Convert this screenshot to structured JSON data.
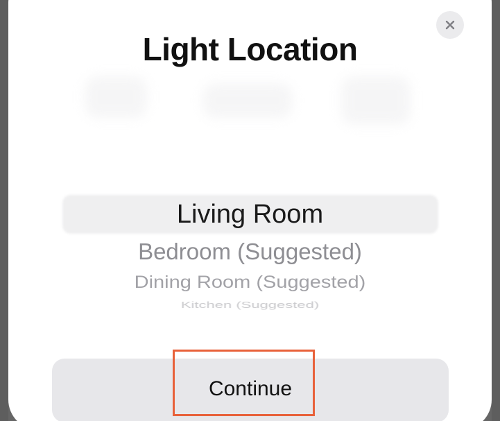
{
  "dialog": {
    "title": "Light Location",
    "close_icon": "close-icon"
  },
  "picker": {
    "selected": "Living Room",
    "options": [
      "Bedroom (Suggested)",
      "Dining Room (Suggested)",
      "Kitchen (Suggested)"
    ]
  },
  "actions": {
    "continue_label": "Continue"
  },
  "colors": {
    "highlight_outline": "#e8613a",
    "button_bg": "#e7e7ea"
  }
}
